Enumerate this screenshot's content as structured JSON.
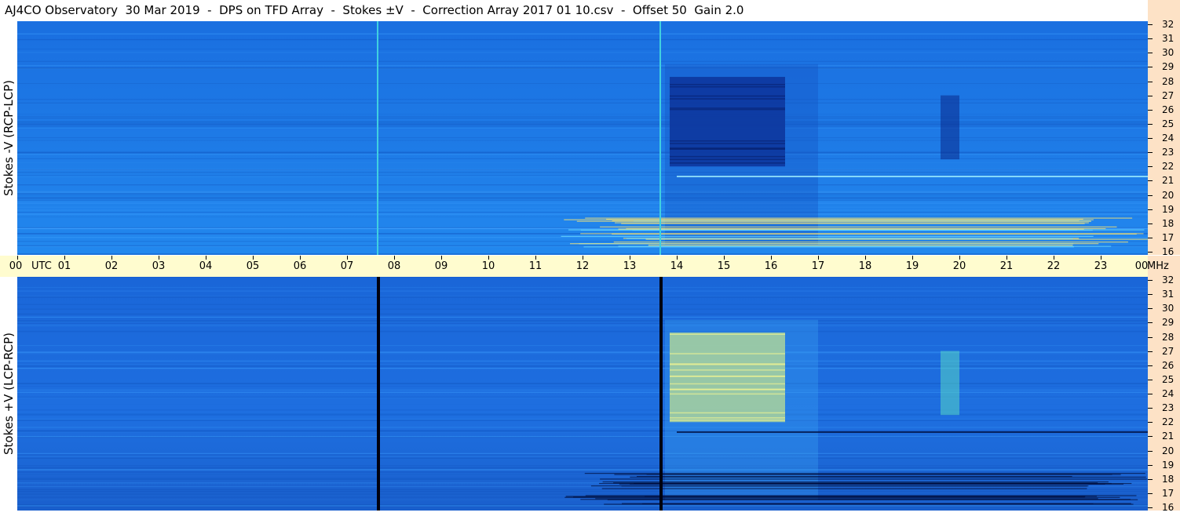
{
  "title": "AJ4CO Observatory  30 Mar 2019  -  DPS on TFD Array  -  Stokes ±V  -  Correction Array 2017 01 10.csv  -  Offset 50  Gain 2.0",
  "panels": {
    "top_label": "Stokes -V (RCP-LCP)",
    "bottom_label": "Stokes +V (LCP-RCP)"
  },
  "time_axis": {
    "utc_label": "UTC",
    "unit_label": "MHz",
    "ticks": [
      "00",
      "01",
      "02",
      "03",
      "04",
      "05",
      "06",
      "07",
      "08",
      "09",
      "10",
      "11",
      "12",
      "13",
      "14",
      "15",
      "16",
      "17",
      "18",
      "19",
      "20",
      "21",
      "22",
      "23",
      "00"
    ]
  },
  "freq_axis": {
    "ticks": [
      "32",
      "31",
      "30",
      "29",
      "28",
      "27",
      "26",
      "25",
      "24",
      "23",
      "22",
      "21",
      "20",
      "19",
      "18",
      "17",
      "16"
    ]
  },
  "colors": {
    "background_blue": "#1e7ae6",
    "deep_blue": "#0a2a8c",
    "burst_yellow": "#e8f070",
    "axis_time_bg": "#fffccf",
    "axis_freq_bg": "#fde2c6"
  },
  "chart_data": {
    "type": "heatmap",
    "title": "AJ4CO Observatory  30 Mar 2019  -  DPS on TFD Array  -  Stokes ±V  -  Correction Array 2017 01 10.csv  -  Offset 50  Gain 2.0",
    "xlabel": "UTC",
    "ylabel_top": "Stokes -V (RCP-LCP)",
    "ylabel_bottom": "Stokes +V (LCP-RCP)",
    "xlim_hours": [
      0,
      24
    ],
    "ylim_mhz": [
      16,
      32
    ],
    "x_ticks": [
      "00",
      "01",
      "02",
      "03",
      "04",
      "05",
      "06",
      "07",
      "08",
      "09",
      "10",
      "11",
      "12",
      "13",
      "14",
      "15",
      "16",
      "17",
      "18",
      "19",
      "20",
      "21",
      "22",
      "23",
      "00"
    ],
    "y_ticks_mhz": [
      32,
      31,
      30,
      29,
      28,
      27,
      26,
      25,
      24,
      23,
      22,
      21,
      20,
      19,
      18,
      17,
      16
    ],
    "events": [
      {
        "name": "",
        "start_hour": 13.85,
        "end_hour": 16.3,
        "low_mhz": 22.0,
        "high_mhz": 28.3,
        "top_level": "low",
        "bottom_level": "high"
      },
      {
        "name": "",
        "start_hour": 19.6,
        "end_hour": 20.0,
        "low_mhz": 22.5,
        "high_mhz": 27.0,
        "top_level": "low",
        "bottom_level": "mid"
      }
    ],
    "vertical_lines_hours": [
      7.65,
      13.65
    ]
  }
}
